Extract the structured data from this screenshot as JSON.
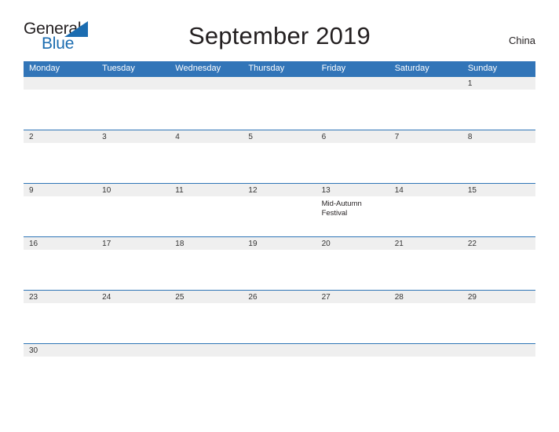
{
  "brand": {
    "name_part1": "General",
    "name_part2": "Blue"
  },
  "header": {
    "title": "September 2019",
    "region": "China"
  },
  "colors": {
    "header_blue": "#3275b8",
    "divider_blue": "#2e75b6",
    "band_gray": "#efefef",
    "logo_blue": "#1b6cb0",
    "text_dark": "#231f20"
  },
  "weekdays": [
    "Monday",
    "Tuesday",
    "Wednesday",
    "Thursday",
    "Friday",
    "Saturday",
    "Sunday"
  ],
  "weeks": [
    [
      {
        "day": ""
      },
      {
        "day": ""
      },
      {
        "day": ""
      },
      {
        "day": ""
      },
      {
        "day": ""
      },
      {
        "day": ""
      },
      {
        "day": "1"
      }
    ],
    [
      {
        "day": "2"
      },
      {
        "day": "3"
      },
      {
        "day": "4"
      },
      {
        "day": "5"
      },
      {
        "day": "6"
      },
      {
        "day": "7"
      },
      {
        "day": "8"
      }
    ],
    [
      {
        "day": "9"
      },
      {
        "day": "10"
      },
      {
        "day": "11"
      },
      {
        "day": "12"
      },
      {
        "day": "13",
        "event": "Mid-Autumn Festival"
      },
      {
        "day": "14"
      },
      {
        "day": "15"
      }
    ],
    [
      {
        "day": "16"
      },
      {
        "day": "17"
      },
      {
        "day": "18"
      },
      {
        "day": "19"
      },
      {
        "day": "20"
      },
      {
        "day": "21"
      },
      {
        "day": "22"
      }
    ],
    [
      {
        "day": "23"
      },
      {
        "day": "24"
      },
      {
        "day": "25"
      },
      {
        "day": "26"
      },
      {
        "day": "27"
      },
      {
        "day": "28"
      },
      {
        "day": "29"
      }
    ],
    [
      {
        "day": "30"
      },
      {
        "day": ""
      },
      {
        "day": ""
      },
      {
        "day": ""
      },
      {
        "day": ""
      },
      {
        "day": ""
      },
      {
        "day": ""
      }
    ]
  ]
}
